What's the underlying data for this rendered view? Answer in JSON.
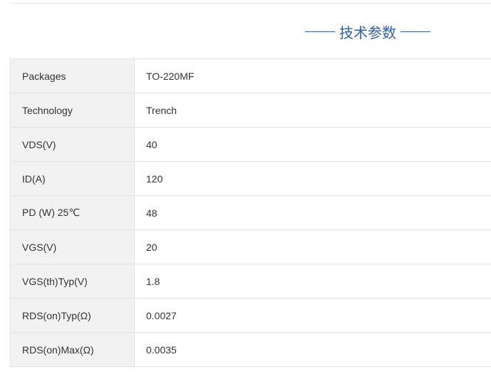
{
  "section_title": "技术参数",
  "specs": [
    {
      "label": "Packages",
      "value": "TO-220MF"
    },
    {
      "label": "Technology",
      "value": "Trench"
    },
    {
      "label": "VDS(V)",
      "value": "40"
    },
    {
      "label": "ID(A)",
      "value": "120"
    },
    {
      "label": "PD (W) 25℃",
      "value": "48"
    },
    {
      "label": "VGS(V)",
      "value": "20"
    },
    {
      "label": "VGS(th)Typ(V)",
      "value": "1.8"
    },
    {
      "label": "RDS(on)Typ(Ω)",
      "value": "0.0027"
    },
    {
      "label": "RDS(on)Max(Ω)",
      "value": "0.0035"
    }
  ],
  "colors": {
    "title_blue": "#2f5fb3",
    "key_cell_bg": "#f2f2f2",
    "border": "#e3e3e3"
  }
}
